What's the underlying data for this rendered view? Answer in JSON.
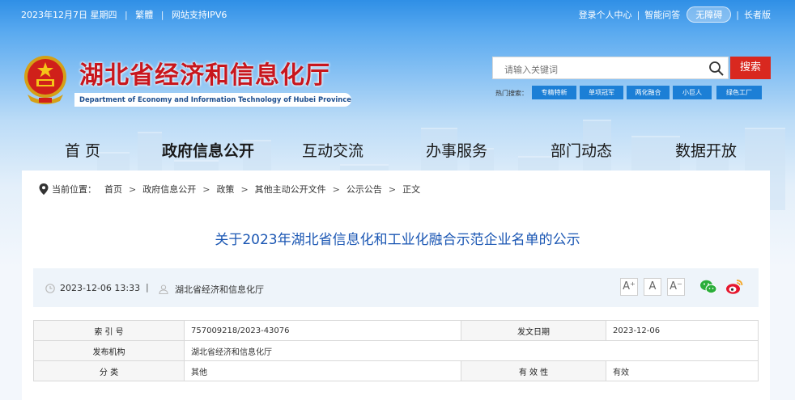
{
  "topbar": {
    "date": "2023年12月7日 星期四",
    "traditional": "繁體",
    "ipv6": "网站支持IPV6",
    "login": "登录个人中心",
    "qa": "智能问答",
    "accessible": "无障碍",
    "elder": "长者版"
  },
  "header": {
    "title": "湖北省经济和信息化厅",
    "subtitle": "Department of Economy and Information Technology of Hubei Province"
  },
  "search": {
    "placeholder": "请输入关键词",
    "button": "搜索",
    "hot_label": "热门搜索：",
    "hot_tags": [
      "专精特新",
      "单项冠军",
      "两化融合",
      "小巨人",
      "绿色工厂"
    ]
  },
  "nav": {
    "items": [
      "首  页",
      "政府信息公开",
      "互动交流",
      "办事服务",
      "部门动态",
      "数据开放"
    ],
    "active_index": 1
  },
  "breadcrumb": {
    "label": "当前位置：",
    "items": [
      "首页",
      "政府信息公开",
      "政策",
      "其他主动公开文件",
      "公示公告",
      "正文"
    ]
  },
  "article": {
    "title": "关于2023年湖北省信息化和工业化融合示范企业名单的公示",
    "datetime": "2023-12-06 13:33",
    "source": "湖北省经济和信息化厅",
    "font_sizes": [
      "A⁺",
      "A",
      "A⁻"
    ]
  },
  "info_table": {
    "index_label": "索 引 号",
    "index_value": "757009218/2023-43076",
    "date_label": "发文日期",
    "date_value": "2023-12-06",
    "org_label": "发布机构",
    "org_value": "湖北省经济和信息化厅",
    "cat_label": "分 类",
    "cat_value": "其他",
    "valid_label": "有 效 性",
    "valid_value": "有效"
  },
  "colors": {
    "brand_red": "#c8161d",
    "search_red": "#d9281f",
    "tag_blue": "#1c7fd6",
    "title_blue": "#1a56b3"
  }
}
